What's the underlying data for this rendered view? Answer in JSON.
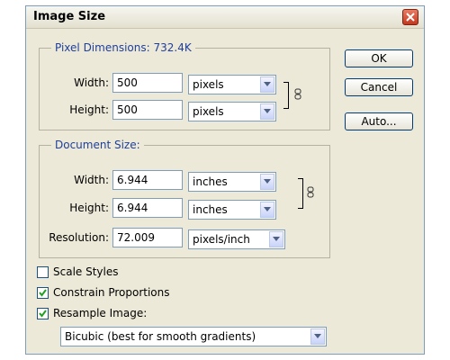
{
  "dialog": {
    "title": "Image Size",
    "close_icon": "close-icon"
  },
  "pixel_dimensions": {
    "label": "Pixel Dimensions:",
    "value": "732.4K",
    "width_label": "Width:",
    "width_value": "500",
    "width_unit": "pixels",
    "height_label": "Height:",
    "height_value": "500",
    "height_unit": "pixels"
  },
  "document_size": {
    "label": "Document Size:",
    "width_label": "Width:",
    "width_value": "6.944",
    "width_unit": "inches",
    "height_label": "Height:",
    "height_value": "6.944",
    "height_unit": "inches",
    "resolution_label": "Resolution:",
    "resolution_value": "72.009",
    "resolution_unit": "pixels/inch"
  },
  "buttons": {
    "ok": "OK",
    "cancel": "Cancel",
    "auto": "Auto..."
  },
  "options": {
    "scale_styles": {
      "label": "Scale Styles",
      "checked": false
    },
    "constrain_proportions": {
      "label": "Constrain Proportions",
      "checked": true
    },
    "resample_image": {
      "label": "Resample Image:",
      "checked": true
    },
    "resample_method": "Bicubic (best for smooth gradients)"
  },
  "colors": {
    "group_label": "#1f3f9c",
    "dialog_bg": "#ece9d8",
    "field_border": "#7f9db9"
  }
}
